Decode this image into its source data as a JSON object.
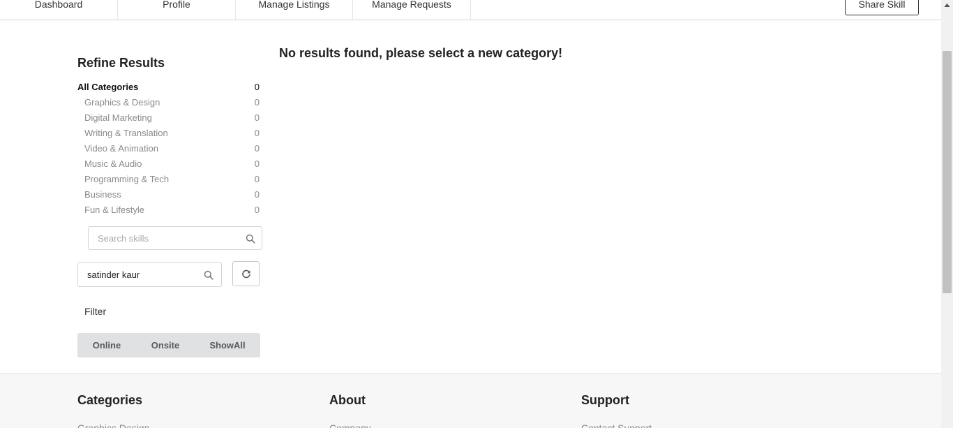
{
  "nav": {
    "items": [
      {
        "label": "Dashboard"
      },
      {
        "label": "Profile"
      },
      {
        "label": "Manage Listings"
      },
      {
        "label": "Manage Requests"
      }
    ],
    "share_label": "Share Skill"
  },
  "sidebar": {
    "title": "Refine Results",
    "categories": [
      {
        "label": "All Categories",
        "count": "0",
        "active": true
      },
      {
        "label": "Graphics & Design",
        "count": "0"
      },
      {
        "label": "Digital Marketing",
        "count": "0"
      },
      {
        "label": "Writing & Translation",
        "count": "0"
      },
      {
        "label": "Video & Animation",
        "count": "0"
      },
      {
        "label": "Music & Audio",
        "count": "0"
      },
      {
        "label": "Programming & Tech",
        "count": "0"
      },
      {
        "label": "Business",
        "count": "0"
      },
      {
        "label": "Fun & Lifestyle",
        "count": "0"
      }
    ],
    "search_placeholder": "Search skills",
    "search_value": "",
    "name_value": "satinder kaur",
    "filter_label": "Filter",
    "filters": [
      {
        "label": "Online"
      },
      {
        "label": "Onsite"
      },
      {
        "label": "ShowAll"
      }
    ]
  },
  "main": {
    "message": "No results found, please select a new category!"
  },
  "footer": {
    "columns": [
      {
        "heading": "Categories",
        "first_link": "Graphics Design"
      },
      {
        "heading": "About",
        "first_link": "Company"
      },
      {
        "heading": "Support",
        "first_link": "Contact Support"
      }
    ]
  },
  "icons": {
    "search": "search-icon",
    "refresh": "refresh-icon",
    "scroll_up": "scroll-up-arrow-icon"
  },
  "colors": {
    "muted_text": "#8a8a8a",
    "filter_bg": "#e0e1e2",
    "footer_bg": "#f7f7f7"
  }
}
